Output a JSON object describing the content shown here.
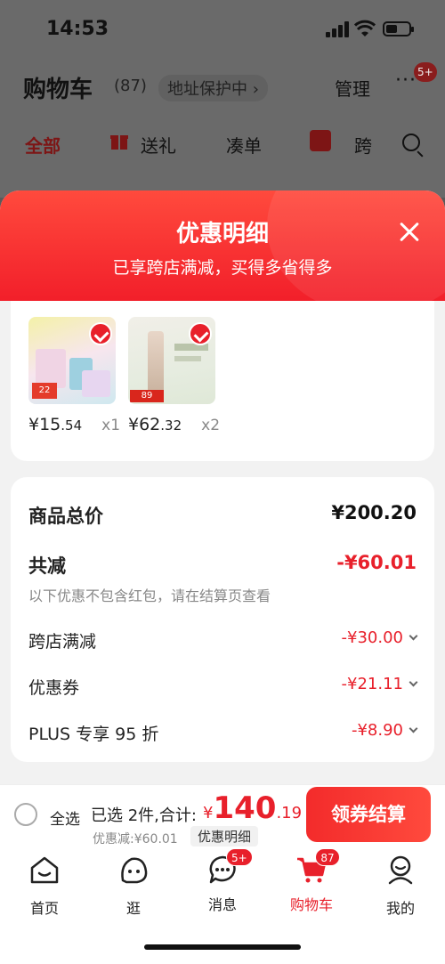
{
  "status_bar": {
    "time": "14:53"
  },
  "cart_page": {
    "title": "购物车",
    "count": "(87)",
    "address_protect": "地址保护中 ›",
    "manage": "管理",
    "more": "···",
    "notif_badge": "5+",
    "tabs": [
      {
        "label": "全部"
      },
      {
        "label": "送礼"
      },
      {
        "label": "凑单"
      },
      {
        "label": "跨"
      }
    ]
  },
  "sheet": {
    "title": "优惠明细",
    "subtitle": "已享跨店满减，买得多省得多",
    "products": [
      {
        "price_int": "¥15",
        "price_dec": ".54",
        "qty": "x1",
        "image_tag": "22"
      },
      {
        "price_int": "¥62",
        "price_dec": ".32",
        "qty": "x2",
        "image_tag": "89"
      }
    ],
    "summary": {
      "total_label": "商品总价",
      "total_value": "¥200.20",
      "reduction_label": "共减",
      "reduction_value": "-¥60.01",
      "note": "以下优惠不包含红包，请在结算页查看",
      "items": [
        {
          "label": "跨店满减",
          "value": "-¥30.00"
        },
        {
          "label": "优惠券",
          "value": "-¥21.11"
        },
        {
          "label": "PLUS 专享 95 折",
          "value": "-¥8.90"
        }
      ]
    }
  },
  "checkout": {
    "select_all": "全选",
    "selected_text": "已选 2件,合计:",
    "total_currency": "¥",
    "total_int": "140",
    "total_dec": ".19",
    "discount_line": "优惠减:¥60.01",
    "detail_button": "优惠明细",
    "pay_button": "领券结算"
  },
  "tabbar": {
    "items": [
      {
        "label": "首页"
      },
      {
        "label": "逛"
      },
      {
        "label": "消息",
        "badge": "5+"
      },
      {
        "label": "购物车",
        "badge": "87"
      },
      {
        "label": "我的"
      }
    ]
  },
  "colors": {
    "accent": "#e8202b",
    "sheet_header": "#f3262e"
  }
}
